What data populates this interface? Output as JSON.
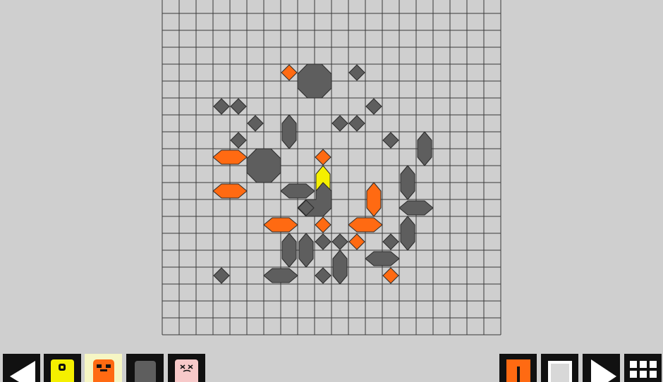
{
  "board": {
    "cols": 20,
    "rows": 20,
    "colors": {
      "background": "#cfcfcf",
      "grid_line": "#3a3a3a",
      "dark_piece": "#5e5e5e",
      "orange_piece": "#ff6a12",
      "yellow_piece": "#f5f000",
      "piece_stroke": "#2a2a2a"
    },
    "pieces": [
      {
        "kind": "diamond",
        "color": "orange",
        "col": 7,
        "row": 4
      },
      {
        "kind": "octagon",
        "color": "dark",
        "col": 8,
        "row": 4,
        "w": 2,
        "h": 2
      },
      {
        "kind": "diamond",
        "color": "dark",
        "col": 11,
        "row": 4
      },
      {
        "kind": "diamond",
        "color": "dark",
        "col": 3,
        "row": 6
      },
      {
        "kind": "diamond",
        "color": "dark",
        "col": 4,
        "row": 6
      },
      {
        "kind": "diamond",
        "color": "dark",
        "col": 12,
        "row": 6
      },
      {
        "kind": "diamond",
        "color": "dark",
        "col": 5,
        "row": 7
      },
      {
        "kind": "vbar",
        "color": "dark",
        "col": 7,
        "row": 7
      },
      {
        "kind": "diamond",
        "color": "dark",
        "col": 10,
        "row": 7
      },
      {
        "kind": "diamond",
        "color": "dark",
        "col": 11,
        "row": 7
      },
      {
        "kind": "diamond",
        "color": "dark",
        "col": 4,
        "row": 8
      },
      {
        "kind": "diamond",
        "color": "dark",
        "col": 13,
        "row": 8
      },
      {
        "kind": "vbar",
        "color": "dark",
        "col": 15,
        "row": 8
      },
      {
        "kind": "hbar",
        "color": "orange",
        "col": 3,
        "row": 9
      },
      {
        "kind": "octagon",
        "color": "dark",
        "col": 5,
        "row": 9,
        "w": 2,
        "h": 2
      },
      {
        "kind": "diamond",
        "color": "orange",
        "col": 9,
        "row": 9
      },
      {
        "kind": "vbar",
        "color": "yellow",
        "col": 9,
        "row": 10
      },
      {
        "kind": "vbar",
        "color": "dark",
        "col": 14,
        "row": 10
      },
      {
        "kind": "hbar",
        "color": "orange",
        "col": 3,
        "row": 11
      },
      {
        "kind": "hbar",
        "color": "dark",
        "col": 7,
        "row": 11
      },
      {
        "kind": "corner",
        "color": "dark",
        "col": 9,
        "row": 11
      },
      {
        "kind": "vbar",
        "color": "orange",
        "col": 12,
        "row": 11
      },
      {
        "kind": "diamond",
        "color": "dark",
        "col": 8,
        "row": 12
      },
      {
        "kind": "hbar",
        "color": "dark",
        "col": 14,
        "row": 12
      },
      {
        "kind": "hbar",
        "color": "orange",
        "col": 6,
        "row": 13
      },
      {
        "kind": "diamond",
        "color": "orange",
        "col": 9,
        "row": 13
      },
      {
        "kind": "hbar",
        "color": "orange",
        "col": 11,
        "row": 13
      },
      {
        "kind": "vbar",
        "color": "dark",
        "col": 14,
        "row": 13
      },
      {
        "kind": "vbar",
        "color": "dark",
        "col": 7,
        "row": 14
      },
      {
        "kind": "vbar",
        "color": "dark",
        "col": 8,
        "row": 14
      },
      {
        "kind": "diamond",
        "color": "dark",
        "col": 9,
        "row": 14
      },
      {
        "kind": "diamond",
        "color": "dark",
        "col": 10,
        "row": 14
      },
      {
        "kind": "diamond",
        "color": "orange",
        "col": 11,
        "row": 14
      },
      {
        "kind": "diamond",
        "color": "dark",
        "col": 13,
        "row": 14
      },
      {
        "kind": "vbar",
        "color": "dark",
        "col": 10,
        "row": 15
      },
      {
        "kind": "hbar",
        "color": "dark",
        "col": 12,
        "row": 15
      },
      {
        "kind": "diamond",
        "color": "dark",
        "col": 3,
        "row": 16
      },
      {
        "kind": "hbar",
        "color": "dark",
        "col": 6,
        "row": 16
      },
      {
        "kind": "diamond",
        "color": "dark",
        "col": 9,
        "row": 16
      },
      {
        "kind": "diamond",
        "color": "orange",
        "col": 13,
        "row": 16
      }
    ]
  },
  "toolbar": {
    "left": [
      {
        "name": "back-button",
        "icon": "back-arrow-icon",
        "bg": "#111111"
      },
      {
        "name": "yellow-character-button",
        "icon": "yellow-character-icon",
        "bg": "#111111"
      },
      {
        "name": "orange-character-button",
        "icon": "orange-character-icon",
        "bg": "#f6f6c4"
      },
      {
        "name": "dark-block-button",
        "icon": "dark-block-icon",
        "bg": "#111111"
      },
      {
        "name": "pink-character-button",
        "icon": "pink-character-icon",
        "bg": "#111111"
      }
    ],
    "right": [
      {
        "name": "orange-split-button",
        "icon": "orange-split-icon",
        "bg": "#111111"
      },
      {
        "name": "stop-button",
        "icon": "stop-icon",
        "bg": "#111111"
      },
      {
        "name": "play-button",
        "icon": "play-icon",
        "bg": "#111111"
      },
      {
        "name": "menu-grid-button",
        "icon": "grid-menu-icon",
        "bg": "#111111"
      }
    ]
  }
}
